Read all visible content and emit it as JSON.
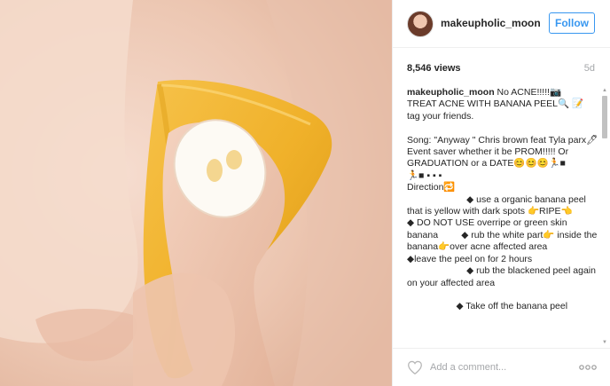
{
  "post": {
    "username": "makeupholic_moon",
    "follow_label": "Follow",
    "views": "8,546 views",
    "age": "5d"
  },
  "caption": {
    "username": "makeupholic_moon",
    "text": " No ACNE!!!!!📷\nTREAT ACNE WITH BANANA PEEL🔍 📝\ntag your friends.\n\nSong: \"Anyway \" Chris brown feat Tyla parx🖊\nEvent saver whether it be PROM!!!!! Or GRADUATION or a DATE😊😊😊🏃■\n🏃■ ▪ ▪ ▪\nDirection🔁\n                       ◆ use a organic banana peel that is yellow with dark spots 👉RIPE👈\n◆ DO NOT USE overripe or green skin banana         ◆ rub the white part👉 inside the banana👉over acne affected area\n◆leave the peel on for 2 hours\n                       ◆ rub the blackened peel again on your affected area\n\n                   ◆ Take off the banana peel"
  },
  "comment": {
    "placeholder": "Add a comment..."
  },
  "icons": {
    "heart": "heart-icon",
    "more": "more-options-icon",
    "avatar": "avatar"
  },
  "colors": {
    "follow_blue": "#3897f0",
    "muted_gray": "#a5a7aa",
    "text": "#262626",
    "border": "#efefef"
  }
}
